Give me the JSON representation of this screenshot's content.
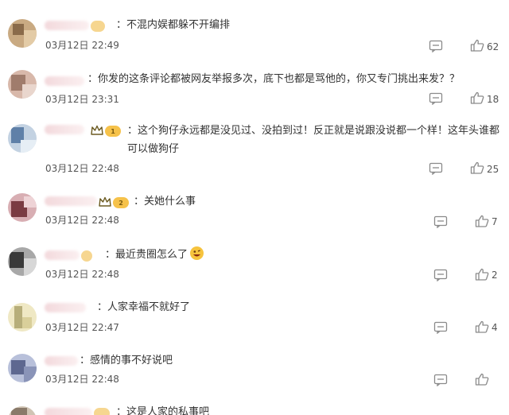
{
  "comments": [
    {
      "text": "不混内娱都躲不开编排",
      "time": "03月12日 22:49",
      "likes": "62",
      "badge": "",
      "avatar_colors": [
        "#b89a70",
        "#d4b48c",
        "#8a6b4a"
      ]
    },
    {
      "text": "你发的这条评论都被网友举报多次，底下也都是骂他的，你又专门挑出来发？？",
      "time": "03月12日 23:31",
      "likes": "18",
      "badge": "",
      "avatar_colors": [
        "#c9a69a",
        "#a88070",
        "#e2c7bd"
      ]
    },
    {
      "text": "这个狗仔永远都是没见过、没拍到过！反正就是说跟没说都一个样！这年头谁都可以做狗仔",
      "time": "03月12日 22:48",
      "likes": "25",
      "badge": "1",
      "avatar_colors": [
        "#6f8fb3",
        "#9fb7d0",
        "#c7d5e3"
      ]
    },
    {
      "text": "关她什么事",
      "time": "03月12日 22:48",
      "likes": "7",
      "badge": "2",
      "avatar_colors": [
        "#7a3b42",
        "#a8606a",
        "#d8aeb3"
      ]
    },
    {
      "text": "最近贵圈怎么了",
      "time": "03月12日 22:48",
      "likes": "2",
      "badge": "",
      "avatar_colors": [
        "#3a3a3a",
        "#707070",
        "#a8a8a8"
      ]
    },
    {
      "text": "人家幸福不就好了",
      "time": "03月12日 22:47",
      "likes": "4",
      "badge": "",
      "avatar_colors": [
        "#d9cf9a",
        "#b7ae7a",
        "#efe8c4"
      ]
    },
    {
      "text": "感情的事不好说吧",
      "time": "03月12日 22:48",
      "likes": "",
      "badge": "",
      "avatar_colors": [
        "#8a94b8",
        "#b8c0da",
        "#5e6890"
      ]
    },
    {
      "text": "这是人家的私事吧",
      "time": "",
      "likes": "",
      "badge": "",
      "avatar_colors": [
        "#b0a090",
        "#d0c4b4",
        "#8a7a6a"
      ]
    }
  ],
  "colors": {
    "text": "#333333",
    "meta": "#555555",
    "icon": "#8a8a8a",
    "badge": "#f6c24a"
  }
}
